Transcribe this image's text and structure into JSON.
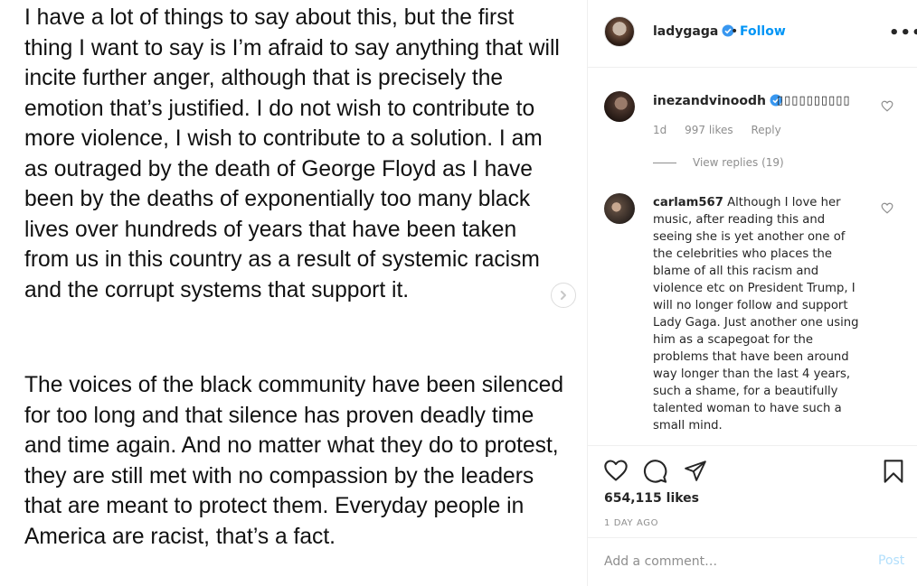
{
  "post_image": {
    "paragraph_1": "I have a lot of things to say about this, but the first thing I want to say is I’m afraid to say anything that will incite further anger, although that is precisely the emotion that’s justified. I do not wish to contribute to more violence, I wish to contribute to a solution. I am as outraged by the death of George Floyd as I have been by the deaths of exponentially too many black lives over hundreds of years that have been taken from us in this country as a result of systemic racism and the corrupt systems that support it.",
    "paragraph_2": "The voices of the black community have been silenced for too long and that silence has proven deadly time and time again. And no matter what they do to protest, they are still met with no compassion by the leaders that are meant to protect them. Everyday people in America are racist, that’s a fact."
  },
  "header": {
    "username": "ladygaga",
    "separator": "•",
    "follow_label": "Follow",
    "more_label": "•••"
  },
  "comments": [
    {
      "username": "inezandvinoodh",
      "text": "▯▯▯▯▯▯▯▯▯▯",
      "age": "1d",
      "likes": "997 likes",
      "reply_label": "Reply",
      "view_replies": "View replies (19)"
    },
    {
      "username": "carlam567",
      "text": "Although I love her music, after reading this and seeing she is yet another one of the celebrities who places the blame of all this racism and violence etc on President Trump, I will no longer follow and support Lady Gaga. Just another one using him as a scapegoat for the problems that have been around way longer than the last 4 years, such a shame, for a beautifully talented woman to have such a small mind."
    }
  ],
  "actions": {
    "likes": "654,115 likes",
    "time": "1 DAY AGO"
  },
  "comment_box": {
    "placeholder": "Add a comment…",
    "post_label": "Post"
  },
  "colors": {
    "link_blue": "#0095f6",
    "muted_gray": "#8e8e8e",
    "post_disabled": "#b2dffc"
  }
}
